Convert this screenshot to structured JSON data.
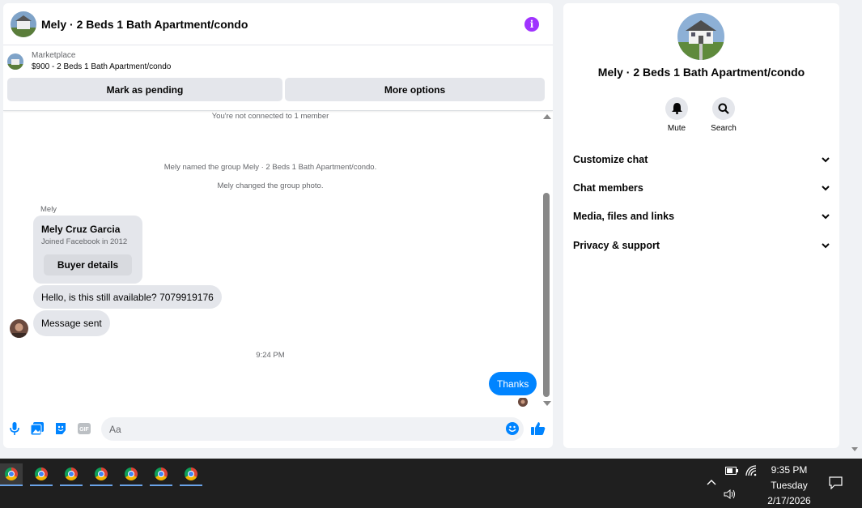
{
  "chat": {
    "title": "Mely · 2 Beds 1 Bath Apartment/condo",
    "marketplace_label": "Marketplace",
    "marketplace_listing": "$900 - 2 Beds 1 Bath Apartment/condo",
    "mark_pending": "Mark as pending",
    "more_options": "More options",
    "not_connected": "You're not connected to 1 member",
    "event_named": "Mely named the group Mely · 2 Beds 1 Bath Apartment/condo.",
    "event_photo": "Mely changed the group photo.",
    "sender_name": "Mely",
    "card_name": "Mely Cruz Garcia",
    "card_sub": "Joined Facebook in 2012",
    "buyer_details": "Buyer details",
    "msg1": "Hello, is this still available? 7079919176",
    "msg2": "Message sent",
    "timestamp": "9:24 PM",
    "out_msg": "Thanks",
    "input_placeholder": "Aa",
    "accent": "#0084ff"
  },
  "side": {
    "title": "Mely · 2 Beds 1 Bath Apartment/condo",
    "mute": "Mute",
    "search": "Search",
    "sections": [
      "Customize chat",
      "Chat members",
      "Media, files and links",
      "Privacy & support"
    ]
  },
  "taskbar": {
    "time": "9:35 PM",
    "day": "Tuesday",
    "date": "2/17/2026"
  }
}
